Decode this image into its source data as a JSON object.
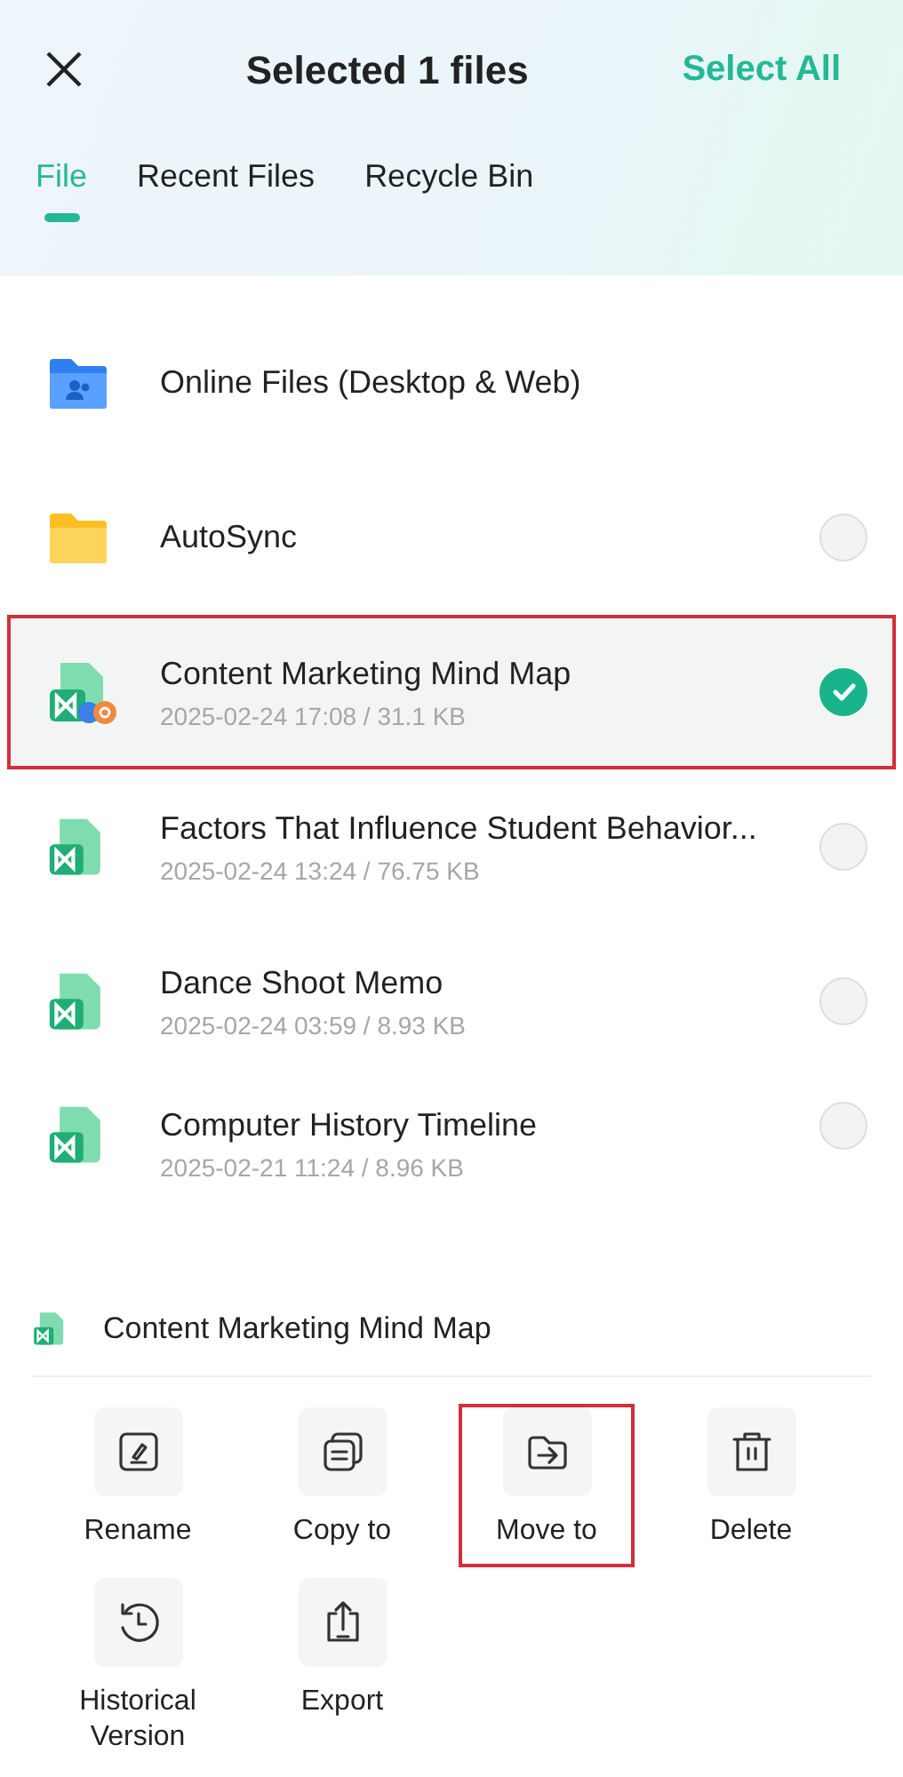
{
  "header": {
    "title": "Selected 1 files",
    "select_all": "Select All"
  },
  "tabs": [
    {
      "label": "File",
      "selected": true
    },
    {
      "label": "Recent Files",
      "selected": false
    },
    {
      "label": "Recycle Bin",
      "selected": false
    }
  ],
  "files": [
    {
      "kind": "online_folder",
      "name": "Online Files (Desktop & Web)",
      "selectable": false,
      "highlighted": false
    },
    {
      "kind": "folder",
      "name": "AutoSync",
      "selectable": true,
      "selected": false,
      "highlighted": false
    },
    {
      "kind": "mindmap_shared",
      "name": "Content Marketing Mind Map",
      "meta": "2025-02-24 17:08 / 31.1 KB",
      "selectable": true,
      "selected": true,
      "highlighted": true
    },
    {
      "kind": "mindmap",
      "name": "Factors That Influence Student Behavior...",
      "meta": "2025-02-24 13:24 / 76.75 KB",
      "selectable": true,
      "selected": false,
      "highlighted": false
    },
    {
      "kind": "mindmap",
      "name": "Dance Shoot Memo",
      "meta": "2025-02-24 03:59 / 8.93 KB",
      "selectable": true,
      "selected": false,
      "highlighted": false
    },
    {
      "kind": "mindmap",
      "name": "Computer History Timeline",
      "meta": "2025-02-21 11:24 / 8.96 KB",
      "selectable": true,
      "selected": false,
      "highlighted": false
    }
  ],
  "sheet": {
    "file_name": "Content Marketing Mind Map",
    "actions": [
      {
        "kind": "rename",
        "label": "Rename",
        "highlighted": false
      },
      {
        "kind": "copy",
        "label": "Copy to",
        "highlighted": false
      },
      {
        "kind": "move",
        "label": "Move to",
        "highlighted": true
      },
      {
        "kind": "delete",
        "label": "Delete",
        "highlighted": false
      },
      {
        "kind": "history",
        "label": "Historical Version",
        "highlighted": false
      },
      {
        "kind": "export",
        "label": "Export",
        "highlighted": false
      }
    ]
  }
}
